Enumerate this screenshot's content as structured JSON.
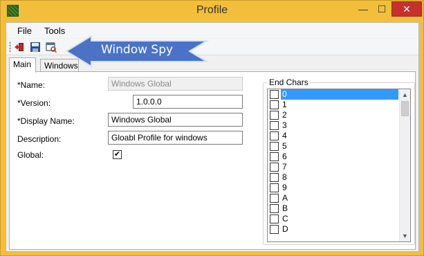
{
  "window": {
    "title": "Profile",
    "minimize": "—",
    "maximize": "☐",
    "close": "✕"
  },
  "menu": [
    "File",
    "Tools"
  ],
  "toolbar": {
    "icons": [
      "exit-icon",
      "save-icon",
      "window-spy-icon"
    ]
  },
  "callout": {
    "text": "Window Spy",
    "color": "#4a73c8"
  },
  "tabs": [
    {
      "label": "Main",
      "active": true
    },
    {
      "label": "Windows",
      "active": false
    }
  ],
  "form": {
    "name_label": "*Name:",
    "name_value": "Windows Global",
    "version_label": "*Version:",
    "version_value": "1.0.0.0",
    "display_label": "*Display Name:",
    "display_value": "Windows Global",
    "description_label": "Description:",
    "description_value": "Gloabl Profile for windows",
    "global_label": "Global:",
    "global_checked": true
  },
  "end_chars": {
    "title": "End Chars",
    "selected": "0",
    "items": [
      "0",
      "1",
      "2",
      "3",
      "4",
      "5",
      "6",
      "7",
      "8",
      "9",
      "A",
      "B",
      "C",
      "D"
    ]
  },
  "colors": {
    "title_bg": "#f3bf3b",
    "close_bg": "#c7312c",
    "select_bg": "#3399ff"
  }
}
